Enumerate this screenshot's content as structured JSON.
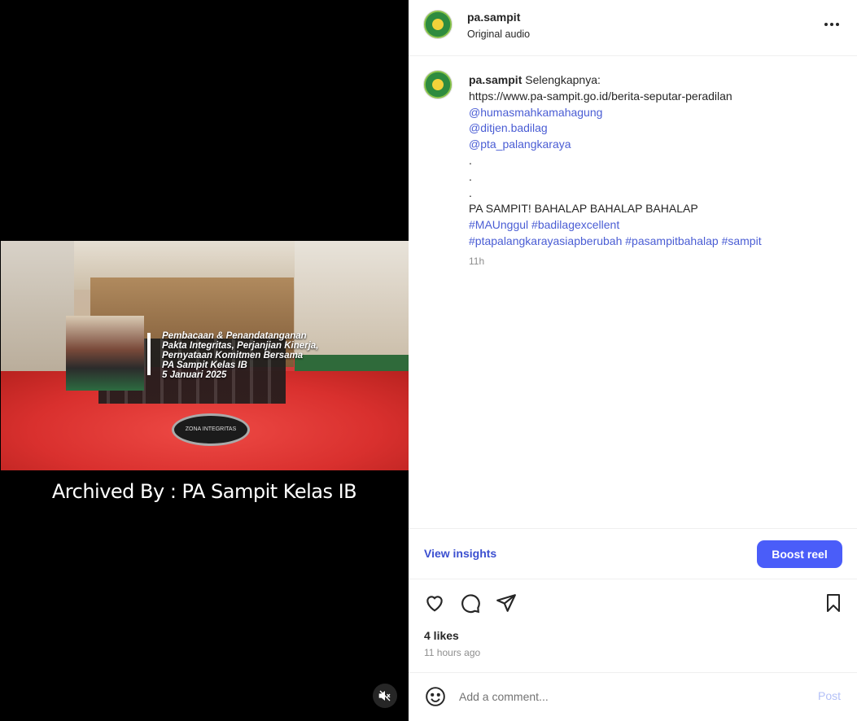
{
  "video": {
    "overlay_caption": {
      "line1": "Pembacaan & Penandatanganan",
      "line2": "Pakta Integritas, Perjanjian Kinerja,",
      "line3": "Pernyataan Komitmen Bersama",
      "line4": "PA Sampit Kelas IB",
      "line5": "5 Januari 2025"
    },
    "emblem_text": "ZONA INTEGRITAS",
    "archived_text": "Archived By : PA Sampit Kelas IB",
    "mute_icon": "speaker-muted-icon"
  },
  "header": {
    "username": "pa.sampit",
    "subtitle": "Original audio",
    "more_icon": "more-horizontal-icon"
  },
  "caption": {
    "username": "pa.sampit",
    "intro": "Selengkapnya:",
    "url": "https://www.pa-sampit.go.id/berita-seputar-peradilan",
    "mentions": [
      "@humasmahkamahagung",
      "@ditjen.badilag",
      "@pta_palangkaraya"
    ],
    "dots": [
      ".",
      ".",
      "."
    ],
    "headline": "PA SAMPIT! BAHALAP BAHALAP BAHALAP",
    "hashtags_line1": "#MAUnggul #badilagexcellent",
    "hashtags_line2": "#ptapalangkarayasiapberubah #pasampitbahalap #sampit",
    "time": "11h"
  },
  "insights": {
    "view_label": "View insights",
    "boost_label": "Boost reel"
  },
  "actions": {
    "icons": [
      "heart-icon",
      "comment-icon",
      "share-icon",
      "bookmark-icon"
    ],
    "likes": "4 likes",
    "ago": "11 hours ago"
  },
  "add_comment": {
    "placeholder": "Add a comment...",
    "post_label": "Post",
    "emoji_icon": "emoji-icon"
  },
  "colors": {
    "link": "#4a5dd4",
    "boost_bg": "#4a5df9",
    "post_disabled": "#b3c0f7"
  }
}
